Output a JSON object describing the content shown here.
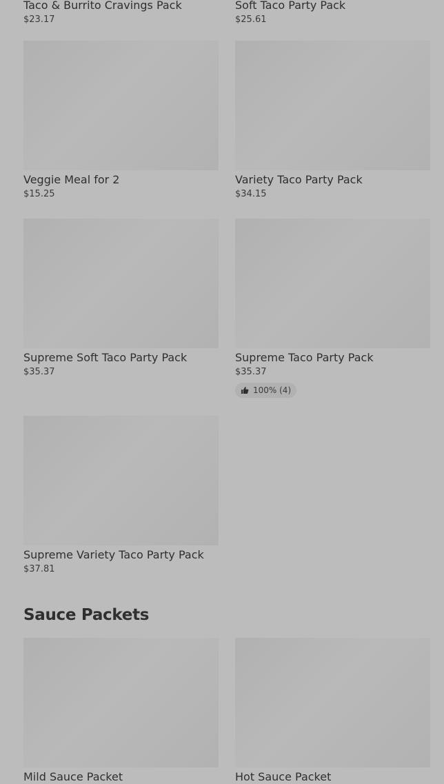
{
  "top_partial": [
    {
      "name": "Taco & Burrito Cravings Pack",
      "price": "$23.17"
    },
    {
      "name": "Soft Taco Party Pack",
      "price": "$25.61"
    }
  ],
  "items": [
    {
      "name": "Veggie Meal for 2",
      "price": "$15.25"
    },
    {
      "name": "Variety Taco Party Pack",
      "price": "$34.15"
    },
    {
      "name": "Supreme Soft Taco Party Pack",
      "price": "$35.37"
    },
    {
      "name": "Supreme Taco Party Pack",
      "price": "$35.37",
      "rating": "100% (4)"
    },
    {
      "name": "Supreme Variety Taco Party Pack",
      "price": "$37.81"
    }
  ],
  "sauce_section": {
    "title": "Sauce Packets",
    "items": [
      {
        "name": "Mild Sauce Packet"
      },
      {
        "name": "Hot Sauce Packet"
      }
    ]
  },
  "icons": {
    "rating": "thumbs-up-icon"
  }
}
